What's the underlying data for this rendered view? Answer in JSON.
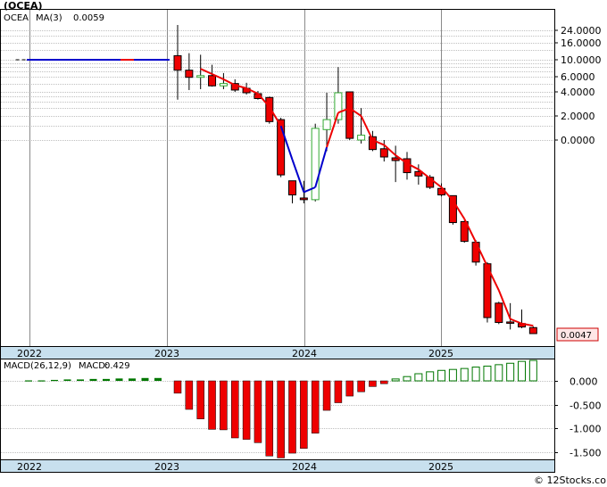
{
  "chart_data": [
    {
      "type": "candlestick",
      "title": "(OCEA)",
      "ticker": "OCEA",
      "indicator_label": "MA(3)",
      "indicator_value": "0.0059",
      "last_price_label": "0.0047",
      "y_tick_labels": [
        "24.0000",
        "16.0000",
        "10.0000",
        "6.0000",
        "4.0000",
        "2.0000",
        "0.0000"
      ],
      "x_tick_labels": [
        "2022",
        "2023",
        "2024",
        "2025"
      ],
      "scale": "log",
      "colors": {
        "down": "#ee0000",
        "up": "#33aa33",
        "ma_early": "#0000cc",
        "ma_late": "#ee0000"
      },
      "candles": [
        {
          "o": 11.2,
          "h": 25.5,
          "l": 3.2,
          "c": 7.3
        },
        {
          "o": 7.3,
          "h": 12.0,
          "l": 4.2,
          "c": 5.9
        },
        {
          "o": 5.9,
          "h": 11.5,
          "l": 4.3,
          "c": 6.2
        },
        {
          "o": 6.2,
          "h": 8.6,
          "l": 4.6,
          "c": 4.7
        },
        {
          "o": 4.7,
          "h": 6.7,
          "l": 4.3,
          "c": 5.0
        },
        {
          "o": 5.0,
          "h": 5.6,
          "l": 4.0,
          "c": 4.2
        },
        {
          "o": 4.4,
          "h": 5.1,
          "l": 3.7,
          "c": 3.9
        },
        {
          "o": 3.8,
          "h": 4.1,
          "l": 3.2,
          "c": 3.3
        },
        {
          "o": 3.4,
          "h": 3.5,
          "l": 1.6,
          "c": 1.7
        },
        {
          "o": 1.8,
          "h": 1.9,
          "l": 0.58,
          "c": 0.6
        },
        {
          "o": 0.55,
          "h": 0.55,
          "l": 0.28,
          "c": 0.38
        },
        {
          "o": 0.34,
          "h": 0.55,
          "l": 0.28,
          "c": 0.32
        },
        {
          "o": 0.32,
          "h": 1.6,
          "l": 0.3,
          "c": 1.4
        },
        {
          "o": 1.35,
          "h": 3.9,
          "l": 0.85,
          "c": 1.8
        },
        {
          "o": 1.8,
          "h": 8.0,
          "l": 1.6,
          "c": 3.9
        },
        {
          "o": 4.0,
          "h": 4.0,
          "l": 1.0,
          "c": 1.05
        },
        {
          "o": 1.0,
          "h": 2.5,
          "l": 0.95,
          "c": 1.15
        },
        {
          "o": 1.1,
          "h": 1.3,
          "l": 0.85,
          "c": 0.87
        },
        {
          "o": 0.88,
          "h": 1.0,
          "l": 0.73,
          "c": 0.78
        },
        {
          "o": 0.77,
          "h": 0.92,
          "l": 0.54,
          "c": 0.74
        },
        {
          "o": 0.76,
          "h": 0.84,
          "l": 0.56,
          "c": 0.62
        },
        {
          "o": 0.63,
          "h": 0.7,
          "l": 0.52,
          "c": 0.59
        },
        {
          "o": 0.58,
          "h": 0.6,
          "l": 0.47,
          "c": 0.5
        },
        {
          "o": 0.48,
          "h": 0.53,
          "l": 0.36,
          "c": 0.38
        },
        {
          "o": 0.37,
          "h": 0.37,
          "l": 0.13,
          "c": 0.14
        },
        {
          "o": 0.145,
          "h": 0.15,
          "l": 0.072,
          "c": 0.075
        },
        {
          "o": 0.073,
          "h": 0.078,
          "l": 0.036,
          "c": 0.04
        },
        {
          "o": 0.038,
          "h": 0.04,
          "l": 0.0065,
          "c": 0.0075
        },
        {
          "o": 0.0115,
          "h": 0.012,
          "l": 0.0062,
          "c": 0.0065
        },
        {
          "o": 0.0066,
          "h": 0.0115,
          "l": 0.0053,
          "c": 0.0065
        },
        {
          "o": 0.0063,
          "h": 0.0095,
          "l": 0.0055,
          "c": 0.0057
        },
        {
          "o": 0.0056,
          "h": 0.0058,
          "l": 0.0037,
          "c": 0.0047
        }
      ],
      "pre_listing_line": {
        "from": 2021.9,
        "to": 2023.0,
        "value": 10.0
      },
      "ma": [
        null,
        null,
        7.6,
        6.5,
        5.6,
        4.8,
        4.4,
        3.8,
        2.6,
        1.5,
        0.75,
        0.42,
        0.5,
        0.9,
        2.2,
        2.5,
        2.0,
        1.0,
        0.93,
        0.8,
        0.71,
        0.65,
        0.57,
        0.5,
        0.31,
        0.16,
        0.073,
        0.035,
        0.017,
        0.0072,
        0.0063,
        0.0059
      ]
    },
    {
      "type": "bar",
      "title": "MACD(26,12,9)",
      "indicator_label": "MACD:",
      "indicator_value": "0.429",
      "y_tick_labels": [
        "0.000",
        "-0.500",
        "-1.000",
        "-1.500"
      ],
      "ylim": [
        -1.65,
        0.45
      ],
      "colors": {
        "neg": "#ee0000",
        "pos": "#007700"
      },
      "flat_values": [
        0.01,
        0.01,
        0.02,
        0.03,
        0.03,
        0.04,
        0.04,
        0.05,
        0.05,
        0.06,
        0.06
      ],
      "values": [
        -0.26,
        -0.6,
        -0.8,
        -1.02,
        -1.03,
        -1.2,
        -1.23,
        -1.3,
        -1.58,
        -1.62,
        -1.52,
        -1.42,
        -1.1,
        -0.62,
        -0.46,
        -0.32,
        -0.23,
        -0.12,
        -0.06,
        0.04,
        0.09,
        0.15,
        0.19,
        0.22,
        0.24,
        0.26,
        0.29,
        0.31,
        0.34,
        0.37,
        0.41,
        0.429
      ]
    }
  ],
  "footer": {
    "watermark": "© 12Stocks.com"
  }
}
